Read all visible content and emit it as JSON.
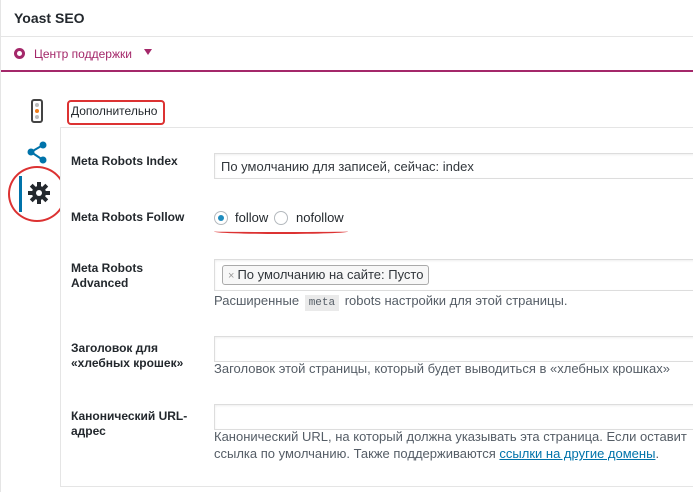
{
  "metabox": {
    "title": "Yoast SEO",
    "help_center_label": "Центр поддержки"
  },
  "section": {
    "tab_label": "Дополнительно"
  },
  "fields": {
    "meta_robots_index": {
      "label": "Meta Robots Index",
      "value": "По умолчанию для записей, сейчас: index"
    },
    "meta_robots_follow": {
      "label": "Meta Robots Follow",
      "options": [
        "follow",
        "nofollow"
      ],
      "selected": "follow"
    },
    "meta_robots_advanced": {
      "label_line1": "Meta Robots",
      "label_line2": "Advanced",
      "tag": "По умолчанию на сайте: Пусто",
      "tag_remove": "×",
      "help_before": "Расширенные",
      "help_code": "meta",
      "help_after": "robots настройки для этой страницы."
    },
    "breadcrumbs_title": {
      "label_line1": "Заголовок для",
      "label_line2": "«хлебных крошек»",
      "value": "",
      "help": "Заголовок этой страницы, который будет выводиться в «хлебных крошках»"
    },
    "canonical_url": {
      "label_line1": "Канонический URL-",
      "label_line2": "адрес",
      "value": "",
      "help_line1": "Канонический URL, на который должна указывать эта страница. Если оставит",
      "help_line2_before": "ссылка по умолчанию. Также поддерживаются",
      "help_link": "ссылки на другие домены",
      "help_line2_after": "."
    }
  },
  "icons": {
    "help": "help-circle-icon",
    "caret": "caret-down-icon",
    "readability": "traffic-light-icon",
    "social": "share-icon",
    "advanced": "gear-icon"
  },
  "colors": {
    "brand": "#a4286a",
    "annotation": "#dc3232",
    "link": "#0073aa",
    "radio_checked": "#1e8cbe"
  }
}
